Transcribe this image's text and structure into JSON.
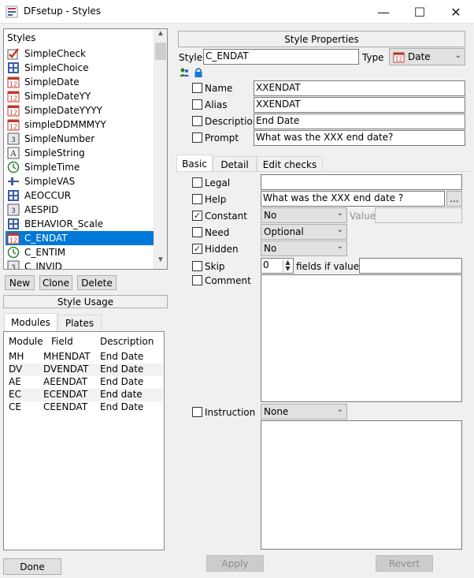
{
  "window": {
    "title": "DFsetup - Styles",
    "controls": [
      "—",
      "☐",
      "✕"
    ]
  },
  "styles_panel": {
    "header": "Styles",
    "items": [
      {
        "label": "SimpleCheck",
        "icon": "check-style-icon"
      },
      {
        "label": "SimpleChoice",
        "icon": "choice-style-icon"
      },
      {
        "label": "SimpleDate",
        "icon": "date-style-icon"
      },
      {
        "label": "SimpleDateYY",
        "icon": "date-style-icon"
      },
      {
        "label": "SimpleDateYYYY",
        "icon": "date-style-icon"
      },
      {
        "label": "simpleDDMMMYY",
        "icon": "date-style-icon"
      },
      {
        "label": "SimpleNumber",
        "icon": "number-style-icon"
      },
      {
        "label": "SimpleString",
        "icon": "string-style-icon"
      },
      {
        "label": "SimpleTime",
        "icon": "time-style-icon"
      },
      {
        "label": "SimpleVAS",
        "icon": "vas-style-icon"
      },
      {
        "label": "AEOCCUR",
        "icon": "choice-style-icon"
      },
      {
        "label": "AESPID",
        "icon": "number-style-icon"
      },
      {
        "label": "BEHAVIOR_Scale",
        "icon": "choice-style-icon"
      },
      {
        "label": "C_ENDAT",
        "icon": "date-style-icon",
        "selected": true
      },
      {
        "label": "C_ENTIM",
        "icon": "time-style-icon"
      },
      {
        "label": "C_INVID",
        "icon": "number-style-icon"
      }
    ]
  },
  "style_buttons": {
    "new": "New",
    "clone": "Clone",
    "delete": "Delete"
  },
  "style_usage": {
    "header": "Style Usage",
    "tabs": [
      "Modules",
      "Plates"
    ],
    "columns": [
      "Module",
      "Field",
      "Description"
    ],
    "rows": [
      [
        "MH",
        "MHENDAT",
        "End Date"
      ],
      [
        "DV",
        "DVENDAT",
        "End Date"
      ],
      [
        "AE",
        "AEENDAT",
        "End Date"
      ],
      [
        "EC",
        "ECENDAT",
        "End date"
      ],
      [
        "CE",
        "CEENDAT",
        "End Date"
      ]
    ]
  },
  "done_label": "Done",
  "properties": {
    "header": "Style Properties",
    "style_label": "Style",
    "style_value": "C_ENDAT",
    "type_label": "Type",
    "type_value": "Date",
    "fields": [
      {
        "label": "Name",
        "value": "XXENDAT"
      },
      {
        "label": "Alias",
        "value": "XXENDAT"
      },
      {
        "label": "Description",
        "value": "End Date"
      },
      {
        "label": "Prompt",
        "value": "What was the XXX end date?"
      }
    ]
  },
  "tabs": [
    "Basic",
    "Detail",
    "Edit checks"
  ],
  "basic": {
    "legal": {
      "label": "Legal",
      "value": ""
    },
    "help": {
      "label": "Help",
      "value": "What was the XXX end date ?",
      "browse": "..."
    },
    "constant": {
      "label": "Constant",
      "checked": true,
      "value": "No",
      "value_label": "Value"
    },
    "need": {
      "label": "Need",
      "value": "Optional"
    },
    "hidden": {
      "label": "Hidden",
      "checked": true,
      "value": "No"
    },
    "skip": {
      "label": "Skip",
      "count": "0",
      "suffix": "fields if value="
    },
    "comment": {
      "label": "Comment"
    },
    "instruction": {
      "label": "Instruction",
      "value": "None"
    }
  },
  "actions": {
    "apply": "Apply",
    "revert": "Revert"
  },
  "colors": {
    "selection": "#0078d7",
    "date_icon": "#c0392b",
    "choice_icon": "#3b5ba9"
  }
}
